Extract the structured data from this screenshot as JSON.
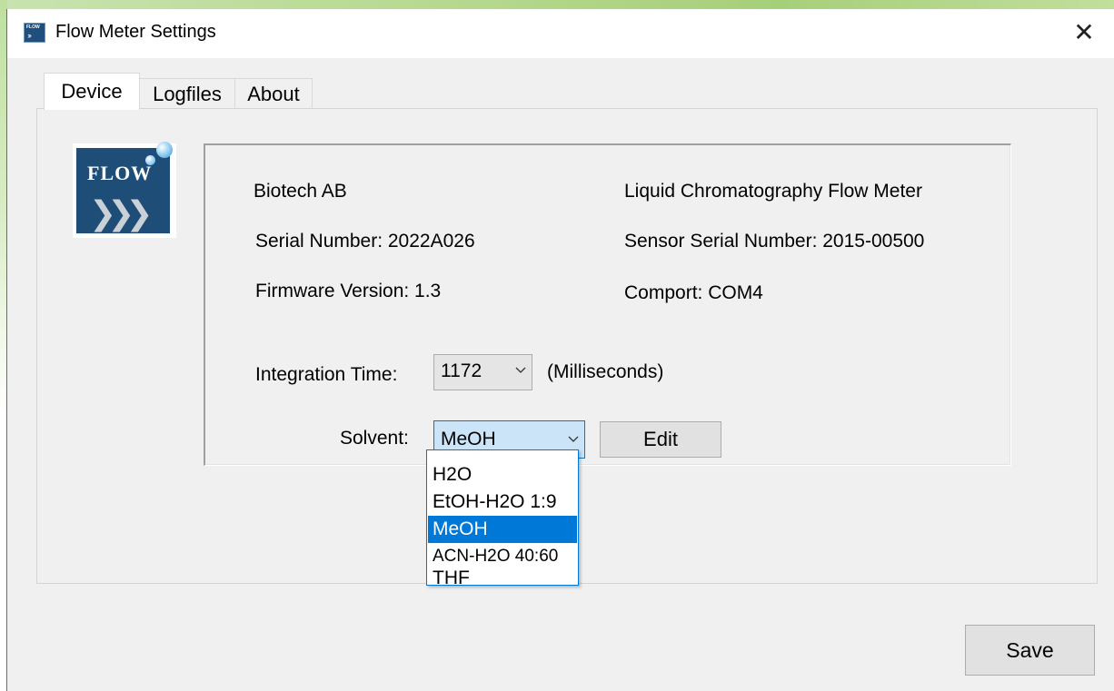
{
  "window": {
    "title": "Flow Meter Settings",
    "close_glyph": "✕"
  },
  "tabs": [
    {
      "label": "Device",
      "active": true
    },
    {
      "label": "Logfiles",
      "active": false
    },
    {
      "label": "About",
      "active": false
    }
  ],
  "logo": {
    "text": "FLOW",
    "icon": "flow-logo-icon"
  },
  "device_info": {
    "company": "Biotech AB",
    "product": "Liquid Chromatography Flow Meter",
    "serial_number": "Serial Number: 2022A026",
    "sensor_serial_number": "Sensor Serial Number: 2015-00500",
    "firmware_version": "Firmware Version: 1.3",
    "comport": "Comport: COM4"
  },
  "integration_time": {
    "label": "Integration Time:",
    "value": "1172",
    "unit": "(Milliseconds)"
  },
  "solvent": {
    "label": "Solvent:",
    "value": "MeOH",
    "edit_label": "Edit",
    "options": [
      "H2O",
      "EtOH-H2O 1:9",
      "MeOH",
      "ACN-H2O 40:60",
      "THF"
    ],
    "selected_index": 2
  },
  "footer": {
    "save_label": "Save"
  },
  "colors": {
    "selection": "#0078d7",
    "logo_bg": "#1e4d78",
    "window_bg": "#f0f0f0"
  }
}
